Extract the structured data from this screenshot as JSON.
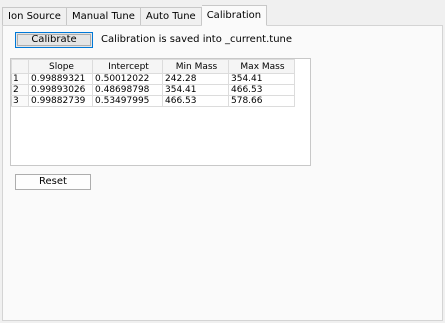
{
  "tabs": [
    {
      "label": "Ion Source"
    },
    {
      "label": "Manual Tune"
    },
    {
      "label": "Auto Tune"
    },
    {
      "label": "Calibration"
    }
  ],
  "active_tab": "Calibration",
  "calibrate_button": "Calibrate",
  "calibration_message": "Calibration is saved into _current.tune",
  "table": {
    "columns": [
      "",
      "Slope",
      "Intercept",
      "Min Mass",
      "Max Mass"
    ],
    "rows": [
      {
        "index": "1",
        "slope": "0.99889321",
        "intercept": "0.50012022",
        "min_mass": "242.28",
        "max_mass": "354.41"
      },
      {
        "index": "2",
        "slope": "0.99893026",
        "intercept": "0.48698798",
        "min_mass": "354.41",
        "max_mass": "466.53"
      },
      {
        "index": "3",
        "slope": "0.99882739",
        "intercept": "0.53497995",
        "min_mass": "466.53",
        "max_mass": "578.66"
      }
    ]
  },
  "reset_button": "Reset"
}
